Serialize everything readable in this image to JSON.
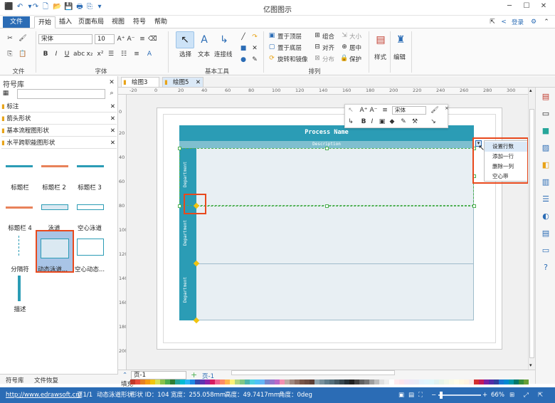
{
  "app": {
    "title": "亿图图示"
  },
  "menu": {
    "file": "文件",
    "tabs": [
      "开始",
      "插入",
      "页面布局",
      "视图",
      "符号",
      "帮助"
    ],
    "login": "登录"
  },
  "ribbon": {
    "font_name": "宋体",
    "font_size": "10",
    "group_labels": {
      "file": "文件",
      "font": "字体",
      "basic_tools": "基本工具",
      "arrange": "排列"
    },
    "tools": {
      "select": "选择",
      "text": "文本",
      "connector": "连接线"
    },
    "arrange": {
      "bring_front": "置于顶层",
      "send_back": "置于底层",
      "rotate_mirror": "旋转和镜像",
      "group": "组合",
      "align": "对齐",
      "distribute": "分布",
      "size": "大小",
      "center": "居中",
      "protect": "保护"
    },
    "style": "样式",
    "edit": "编辑"
  },
  "library": {
    "title": "符号库",
    "categories": [
      "标注",
      "箭头形状",
      "基本流程图形状",
      "水平跨职能图形状"
    ],
    "shapes": [
      "标题栏",
      "标题栏 2",
      "标题栏 3",
      "标题栏 4",
      "泳道",
      "空心泳道",
      "分隔符",
      "动态泳道...",
      "空心动态...",
      "描述"
    ],
    "bottom_tabs": [
      "符号库",
      "文件恢复"
    ]
  },
  "doc_tabs": [
    "绘图3",
    "绘图5"
  ],
  "ruler_h": [
    "-20",
    "0",
    "20",
    "40",
    "60",
    "80",
    "100",
    "120",
    "140",
    "160",
    "180",
    "200",
    "220",
    "240",
    "260",
    "280",
    "300"
  ],
  "ruler_v": [
    "0",
    "20",
    "40",
    "60",
    "80",
    "100",
    "120",
    "140",
    "160",
    "180",
    "200"
  ],
  "diagram": {
    "title": "Process Name",
    "description": "Description",
    "lanes": [
      "Department",
      "Department",
      "Department"
    ]
  },
  "float_toolbar": {
    "font": "宋体"
  },
  "context_menu": {
    "items": [
      "设置行数",
      "添加一行",
      "删除一列",
      "空心带"
    ]
  },
  "pagebar": {
    "page_select": "页-1",
    "page_tab": "页-1",
    "fill_label": "填充"
  },
  "palette": [
    "#c0392b",
    "#e74c3c",
    "#e67e22",
    "#f39c12",
    "#f1c40f",
    "#d4e157",
    "#8bc34a",
    "#4caf50",
    "#2e7d32",
    "#26a69a",
    "#00bcd4",
    "#29b6f6",
    "#1e88e5",
    "#3949ab",
    "#5e35b1",
    "#8e24aa",
    "#d81b60",
    "#f06292",
    "#ff8a65",
    "#ffb74d",
    "#fff176",
    "#aed581",
    "#81c784",
    "#4db6ac",
    "#4dd0e1",
    "#4fc3f7",
    "#64b5f6",
    "#7986cb",
    "#9575cd",
    "#ba68c8",
    "#f48fb1",
    "#bcaaa4",
    "#a1887f",
    "#8d6e63",
    "#795548",
    "#6d4c41",
    "#5d4037",
    "#90a4ae",
    "#78909c",
    "#607d8b",
    "#546e7a",
    "#455a64",
    "#37474f",
    "#263238",
    "#212121",
    "#424242",
    "#616161",
    "#757575",
    "#9e9e9e",
    "#bdbdbd",
    "#e0e0e0",
    "#eeeeee",
    "#ffffff",
    "#ffebee",
    "#fce4ec",
    "#f3e5f5",
    "#ede7f6",
    "#e8eaf6",
    "#e3f2fd",
    "#e1f5fe",
    "#e0f7fa",
    "#e0f2f1",
    "#e8f5e9",
    "#f1f8e9",
    "#f9fbe7",
    "#fffde7",
    "#fff8e1",
    "#fff3e0",
    "#fbe9e7",
    "#d32f2f",
    "#c2185b",
    "#7b1fa2",
    "#512da8",
    "#303f9f",
    "#1976d2",
    "#0288d1",
    "#0097a7",
    "#00796b",
    "#388e3c",
    "#689f38",
    "#afb42b",
    "#fbc02d",
    "#ffa000",
    "#f57c00",
    "#e64a19",
    "#5d4037",
    "#616161",
    "#455a64",
    "#000000"
  ],
  "status": {
    "url": "http://www.edrawsoft.cn/",
    "page": "页1/1",
    "shape": "动态泳道形状",
    "shape_id": "形状 ID：104",
    "width": "宽度：255.058mm",
    "height": "高度：49.7417mm",
    "angle": "角度：0deg",
    "zoom": "66%"
  },
  "colors": {
    "accent": "#2b6cb5",
    "lane": "#2b9cb5",
    "lane_body": "#e8eff3",
    "highlight": "#e8491d"
  }
}
